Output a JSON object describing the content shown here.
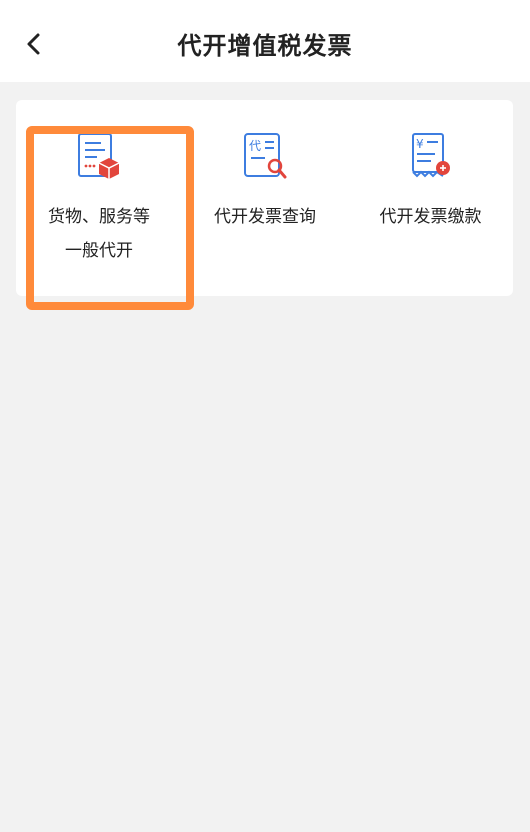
{
  "header": {
    "title": "代开增值税发票",
    "back_icon": "chevron-left-icon"
  },
  "menu": {
    "items": [
      {
        "label": "货物、服务等\n一般代开",
        "icon": "invoice-package-icon",
        "highlighted": true
      },
      {
        "label": "代开发票查询",
        "icon": "invoice-search-icon",
        "highlighted": false
      },
      {
        "label": "代开发票缴款",
        "icon": "invoice-payment-icon",
        "highlighted": false
      }
    ]
  },
  "colors": {
    "highlight": "#ff8a3a",
    "icon_blue": "#3d7de0",
    "icon_red": "#e2453c",
    "background": "#f2f2f2"
  }
}
